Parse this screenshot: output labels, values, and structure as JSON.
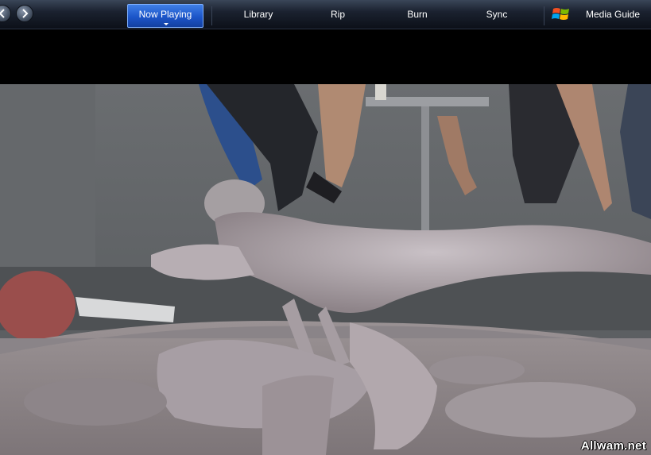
{
  "toolbar": {
    "tabs": [
      {
        "label": "Now Playing",
        "active": true
      },
      {
        "label": "Library",
        "active": false
      },
      {
        "label": "Rip",
        "active": false
      },
      {
        "label": "Burn",
        "active": false
      },
      {
        "label": "Sync",
        "active": false
      },
      {
        "label": "Media Guide",
        "active": false
      }
    ],
    "icons": {
      "back": "arrow-left-icon",
      "forward": "arrow-right-icon",
      "logo": "windows-logo-icon"
    },
    "accent_color": "#1c55c9"
  },
  "video": {
    "watermark": "Allwam.net"
  }
}
